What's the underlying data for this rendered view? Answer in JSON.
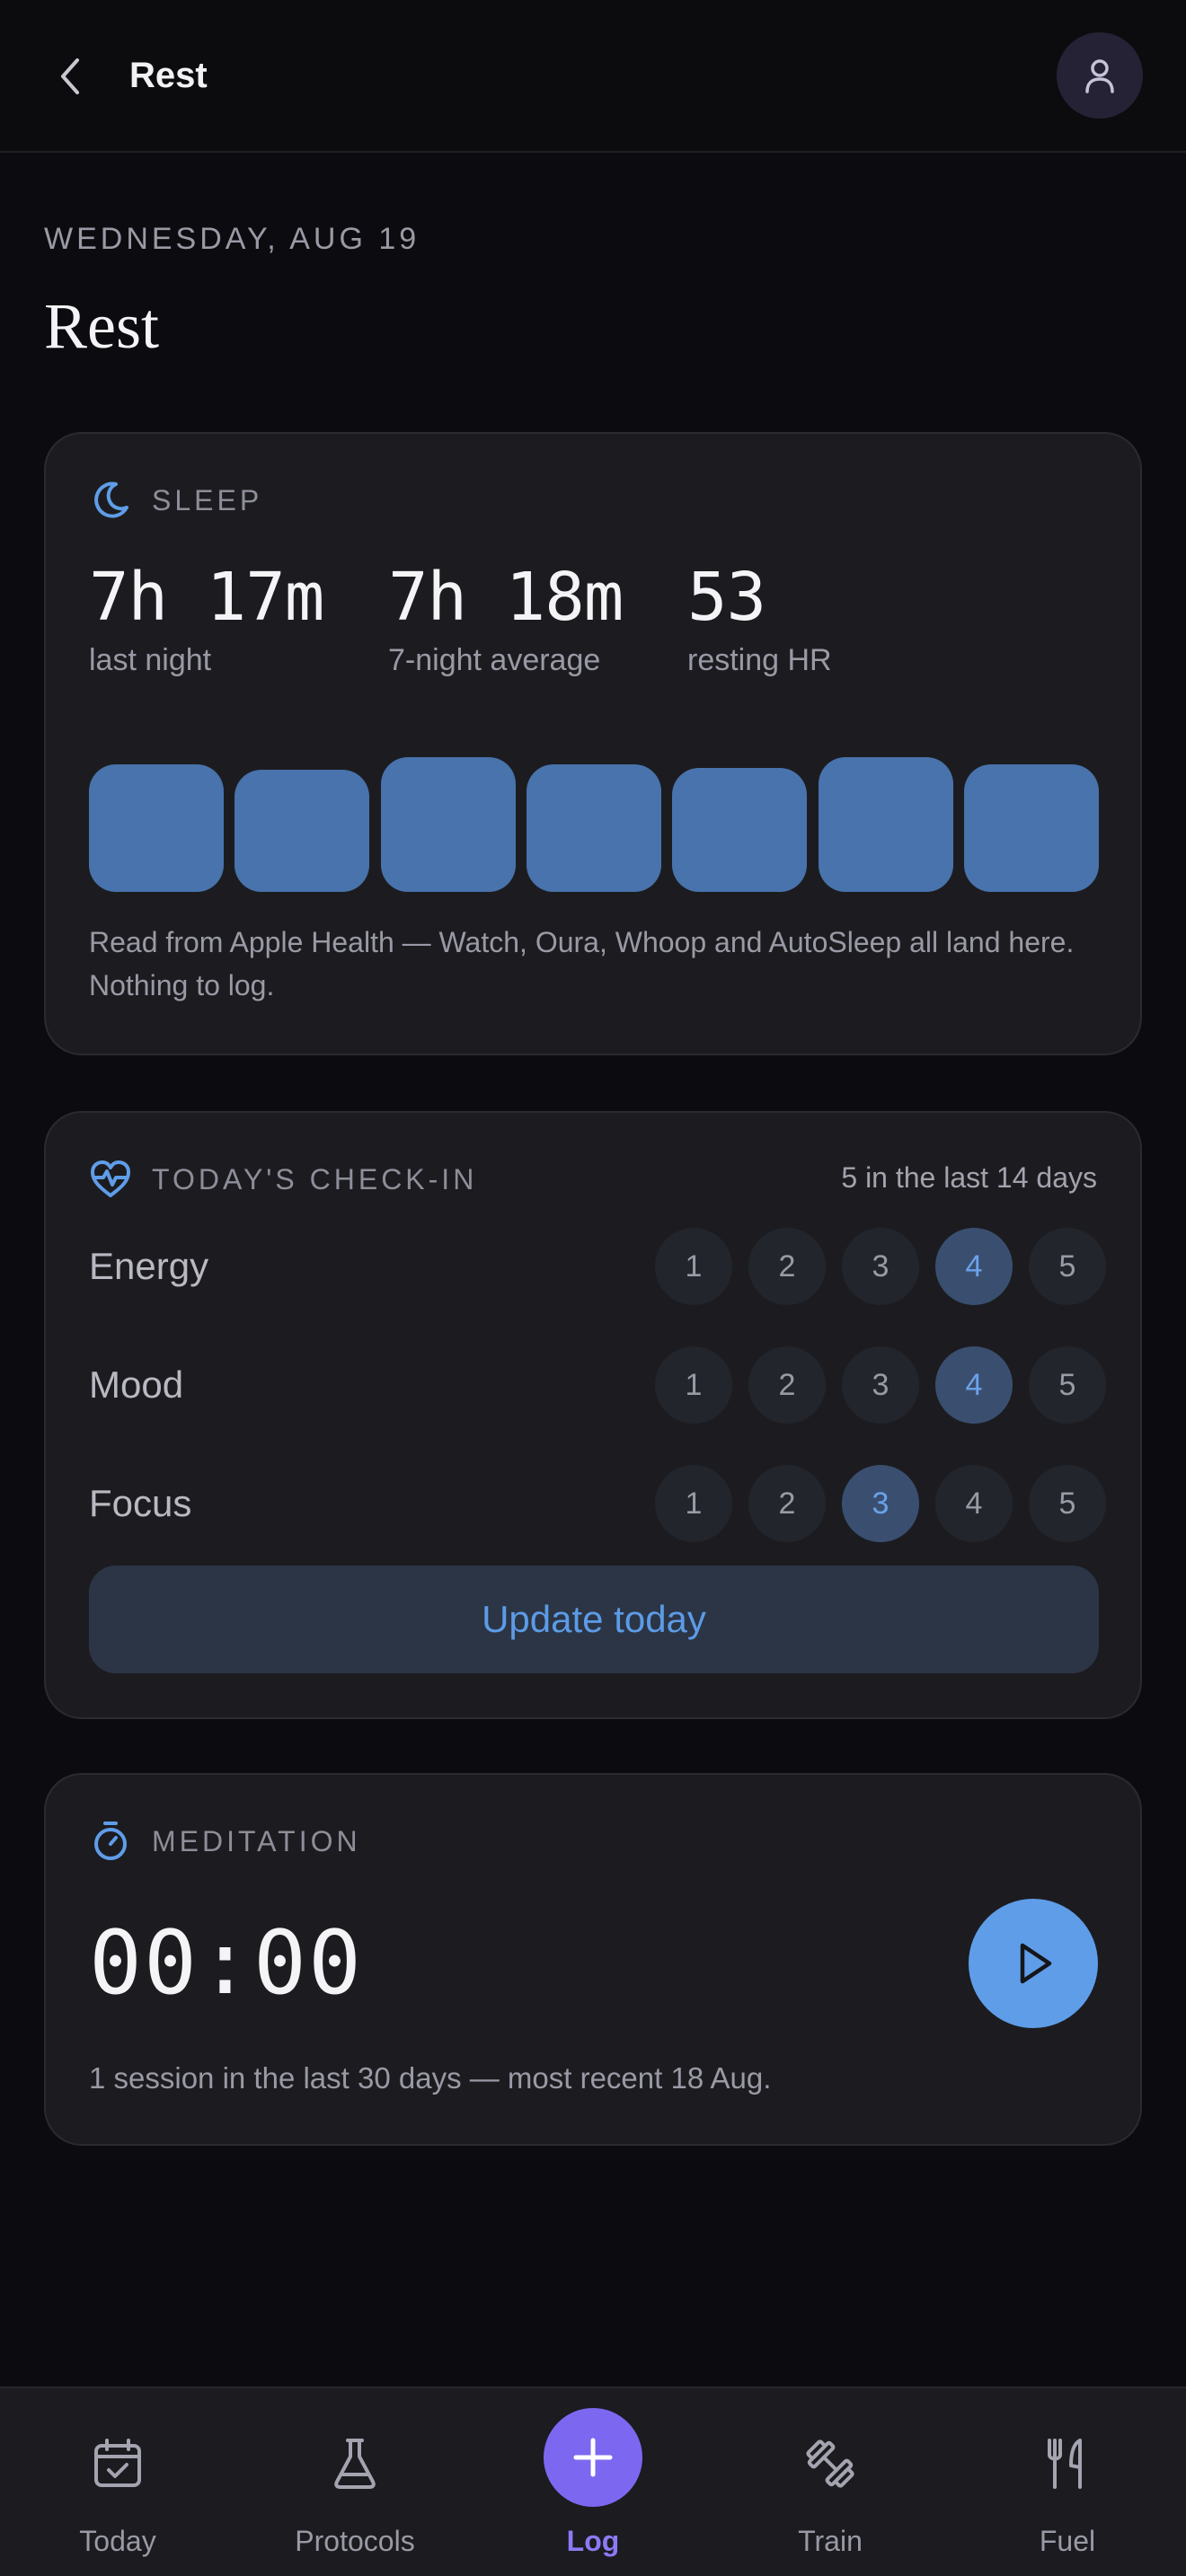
{
  "header": {
    "title": "Rest"
  },
  "page": {
    "date": "WEDNESDAY, AUG 19",
    "title": "Rest"
  },
  "sleep": {
    "label": "SLEEP",
    "stats": [
      {
        "value": "7h 17m",
        "caption": "last night"
      },
      {
        "value": "7h 18m",
        "caption": "7-night average"
      },
      {
        "value": "53",
        "caption": "resting HR"
      }
    ],
    "nights_relative": [
      0.95,
      0.91,
      1.0,
      0.95,
      0.92,
      1.0,
      0.95
    ],
    "note": "Read from Apple Health — Watch, Oura, Whoop and AutoSleep all land here. Nothing to log."
  },
  "checkin": {
    "label": "TODAY'S CHECK-IN",
    "count": "5 in the last 14 days",
    "rows": [
      {
        "label": "Energy",
        "selected": 4
      },
      {
        "label": "Mood",
        "selected": 4
      },
      {
        "label": "Focus",
        "selected": 3
      }
    ],
    "scale": [
      "1",
      "2",
      "3",
      "4",
      "5"
    ],
    "button": "Update today"
  },
  "meditation": {
    "label": "MEDITATION",
    "timer": "00:00",
    "note": "1 session in the last 30 days — most recent 18 Aug."
  },
  "nav": {
    "items": [
      {
        "label": "Today",
        "icon": "calendar-check-icon"
      },
      {
        "label": "Protocols",
        "icon": "flask-icon"
      },
      {
        "label": "Log",
        "icon": "plus-icon",
        "active": true
      },
      {
        "label": "Train",
        "icon": "dumbbell-icon"
      },
      {
        "label": "Fuel",
        "icon": "utensils-icon"
      }
    ]
  },
  "colors": {
    "accent": "#5f9de8",
    "log": "#7c68f0",
    "bar": "#4873ac"
  }
}
